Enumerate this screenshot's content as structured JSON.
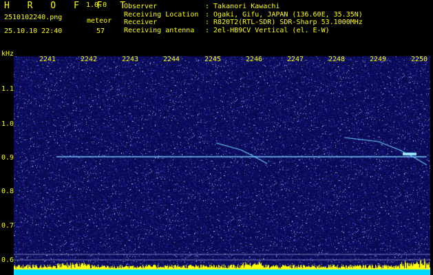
{
  "header": {
    "brand": "H R O F F T",
    "version": "1.0.0",
    "filename": "2510102240.png",
    "meteor_label": "meteor",
    "timestamp": "25.10.10 22:40",
    "meteor_count": "57"
  },
  "station": [
    {
      "label": "Observer",
      "value": ": Takanori Kawachi"
    },
    {
      "label": "Receiving Location",
      "value": ": Ogaki, Gifu, JAPAN (136.60E, 35.35N)"
    },
    {
      "label": "Receiver",
      "value": ": R820T2(RTL-SDR) SDR-Sharp 53.1000MHz"
    },
    {
      "label": "Receiving antenna",
      "value": ": 2el-HB9CV Vertical (el. E-W)"
    }
  ],
  "axis": {
    "unit": "kHz",
    "y_ticks": [
      "1.1",
      "1.0",
      "0.9",
      "0.8",
      "0.7",
      "0.6"
    ],
    "x_ticks": [
      "2241",
      "2242",
      "2243",
      "2244",
      "2245",
      "2246",
      "2247",
      "2248",
      "2249",
      "2250"
    ]
  },
  "colors": {
    "background": "#000000",
    "label": "#ffff00",
    "spectrum": "#0a0a5c",
    "carrier": "#7ac8ff",
    "level_bar": "#ffff00",
    "level_base": "#00d8ff"
  }
}
